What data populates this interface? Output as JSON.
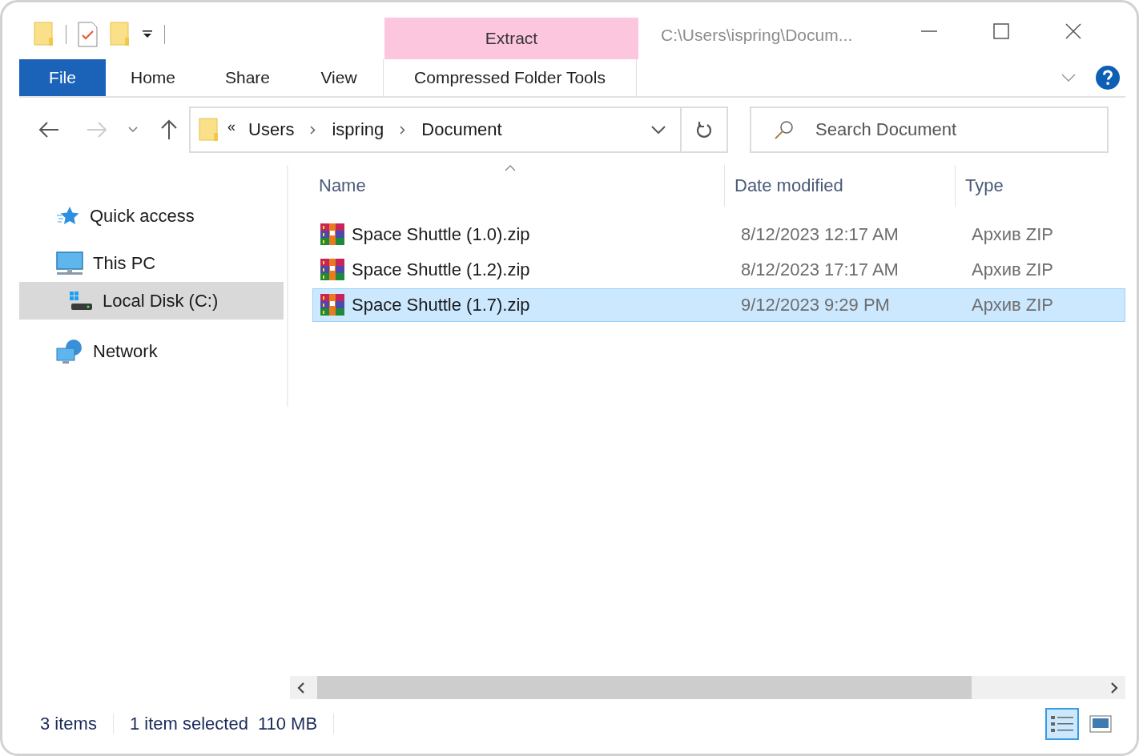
{
  "title_bar": {
    "path": "C:\\Users\\ispring\\Docum..."
  },
  "ribbon": {
    "tabs": [
      {
        "label": "File",
        "kind": "file"
      },
      {
        "label": "Home",
        "kind": "tab"
      },
      {
        "label": "Share",
        "kind": "tab"
      },
      {
        "label": "View",
        "kind": "tab"
      }
    ],
    "context_tab": {
      "group": "Extract",
      "label": "Compressed Folder Tools"
    }
  },
  "address_bar": {
    "overflow": "«",
    "breadcrumb": [
      "Users",
      "ispring",
      "Document"
    ]
  },
  "search": {
    "placeholder": "Search Document"
  },
  "sidebar": {
    "items": [
      {
        "label": "Quick access",
        "kind": "quick",
        "selected": false
      },
      {
        "label": "This PC",
        "kind": "pc",
        "selected": false,
        "children": [
          {
            "label": "Local Disk (C:)",
            "kind": "disk",
            "selected": true
          }
        ]
      },
      {
        "label": "Network",
        "kind": "network",
        "selected": false
      }
    ]
  },
  "table": {
    "columns": [
      {
        "label": "Name",
        "sorted": true
      },
      {
        "label": "Date modified",
        "sorted": false
      },
      {
        "label": "Type",
        "sorted": false
      }
    ],
    "rows": [
      {
        "name": "Space Shuttle (1.0).zip",
        "date": "8/12/2023 12:17 AM",
        "type": "Архив ZIP",
        "selected": false
      },
      {
        "name": "Space Shuttle (1.2).zip",
        "date": "8/12/2023 17:17 AM",
        "type": "Архив ZIP",
        "selected": false
      },
      {
        "name": "Space Shuttle (1.7).zip",
        "date": "9/12/2023 9:29 PM",
        "type": "Архив ZIP",
        "selected": true
      }
    ]
  },
  "status_bar": {
    "item_count": "3 items",
    "selection": "1 item selected",
    "size": "110 MB",
    "views": [
      {
        "kind": "details",
        "selected": true
      },
      {
        "kind": "large-icons",
        "selected": false
      }
    ]
  }
}
